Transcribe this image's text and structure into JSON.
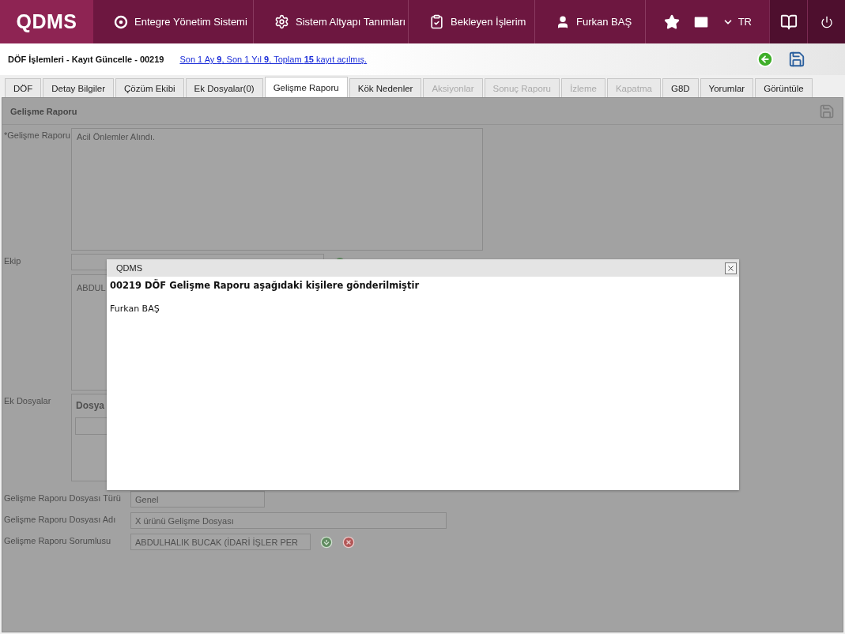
{
  "header": {
    "logo": "QDMS",
    "nav": [
      {
        "kind": "system",
        "label": "Entegre Yönetim Sistemi"
      },
      {
        "kind": "settings",
        "label": "Sistem Altyapı Tanımları"
      },
      {
        "kind": "tasks",
        "label": "Bekleyen İşlerim"
      },
      {
        "kind": "user",
        "label": "Furkan BAŞ"
      }
    ],
    "language": "TR"
  },
  "page": {
    "title": "DÖF İşlemleri - Kayıt Güncelle - 00219",
    "history_link": "Son 1 Ay **9**, Son 1 Yıl **9**, Toplam **15** kayıt açılmış."
  },
  "tabs": [
    {
      "label": "DÖF",
      "selected": false,
      "disabled": false
    },
    {
      "label": "Detay Bilgiler",
      "selected": false,
      "disabled": false
    },
    {
      "label": "Çözüm Ekibi",
      "selected": false,
      "disabled": false
    },
    {
      "label": "Ek Dosyalar(0)",
      "selected": false,
      "disabled": false
    },
    {
      "label": "Gelişme Raporu",
      "selected": true,
      "disabled": false
    },
    {
      "label": "Kök Nedenler",
      "selected": false,
      "disabled": false
    },
    {
      "label": "Aksiyonlar",
      "selected": false,
      "disabled": true
    },
    {
      "label": "Sonuç Raporu",
      "selected": false,
      "disabled": true
    },
    {
      "label": "İzleme",
      "selected": false,
      "disabled": true
    },
    {
      "label": "Kapatma",
      "selected": false,
      "disabled": true
    },
    {
      "label": "G8D",
      "selected": false,
      "disabled": false
    },
    {
      "label": "Yorumlar",
      "selected": false,
      "disabled": false
    },
    {
      "label": "Görüntüle",
      "selected": false,
      "disabled": false
    }
  ],
  "panel": {
    "title": "Gelişme Raporu",
    "report": {
      "label": "*Gelişme Raporu",
      "value": "Acil Önlemler Alındı."
    },
    "team": {
      "label": "Ekip",
      "members": [
        "ABDUL"
      ]
    },
    "attachments": {
      "label": "Ek Dosyalar",
      "column_1": "Dosya"
    },
    "file_type": {
      "label": "Gelişme Raporu Dosyası Türü",
      "value": "Genel"
    },
    "file_name": {
      "label": "Gelişme Raporu Dosyası Adı",
      "value": "X ürünü Gelişme Dosyası"
    },
    "owner": {
      "label": "Gelişme Raporu Sorumlusu",
      "value": "ABDULHALIK BUCAK (İDARİ İŞLER PER"
    }
  },
  "dialog": {
    "title": "QDMS",
    "message": "00219 DÖF Gelişme Raporu aşağıdaki kişilere gönderilmiştir",
    "recipients": [
      "Furkan BAŞ"
    ]
  }
}
